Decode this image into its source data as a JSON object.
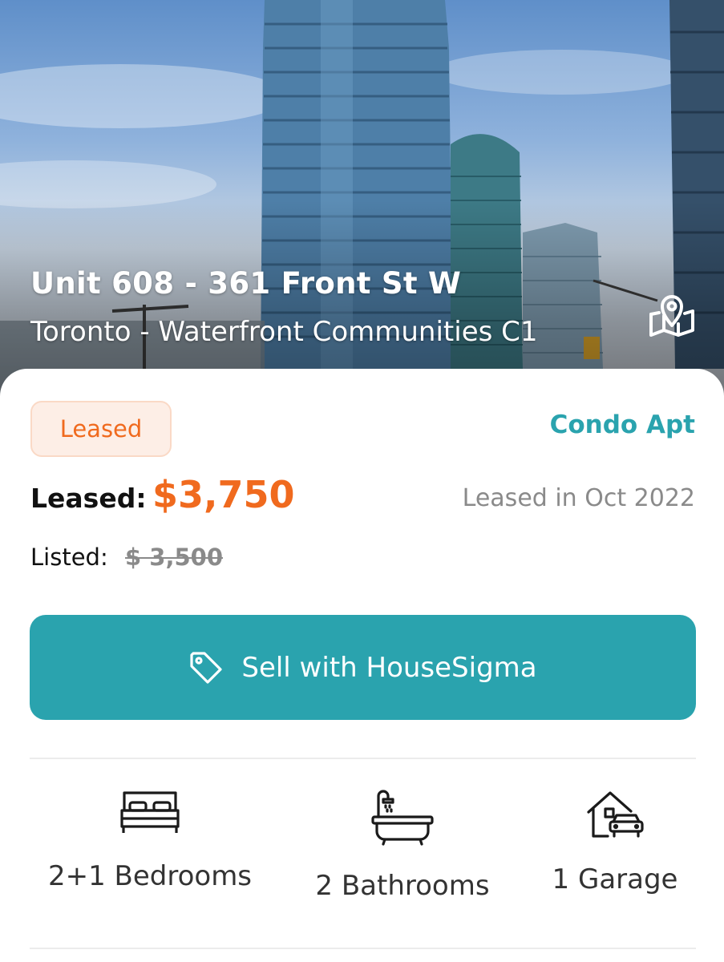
{
  "listing": {
    "title": "Unit 608 - 361 Front St W",
    "location": "Toronto - Waterfront Communities C1",
    "status": "Leased",
    "property_type": "Condo Apt",
    "leased_label": "Leased:",
    "leased_price": "$3,750",
    "leased_date": "Leased in Oct 2022",
    "listed_label": "Listed:",
    "listed_price": "$ 3,500"
  },
  "actions": {
    "sell_label": "Sell with HouseSigma"
  },
  "features": [
    {
      "icon": "bed-icon",
      "label": "2+1 Bedrooms"
    },
    {
      "icon": "bathtub-icon",
      "label": "2 Bathrooms"
    },
    {
      "icon": "garage-icon",
      "label": "1 Garage"
    }
  ],
  "colors": {
    "accent": "#2aa3ae",
    "price": "#f06a1e",
    "badge_bg": "#fdeee6"
  }
}
